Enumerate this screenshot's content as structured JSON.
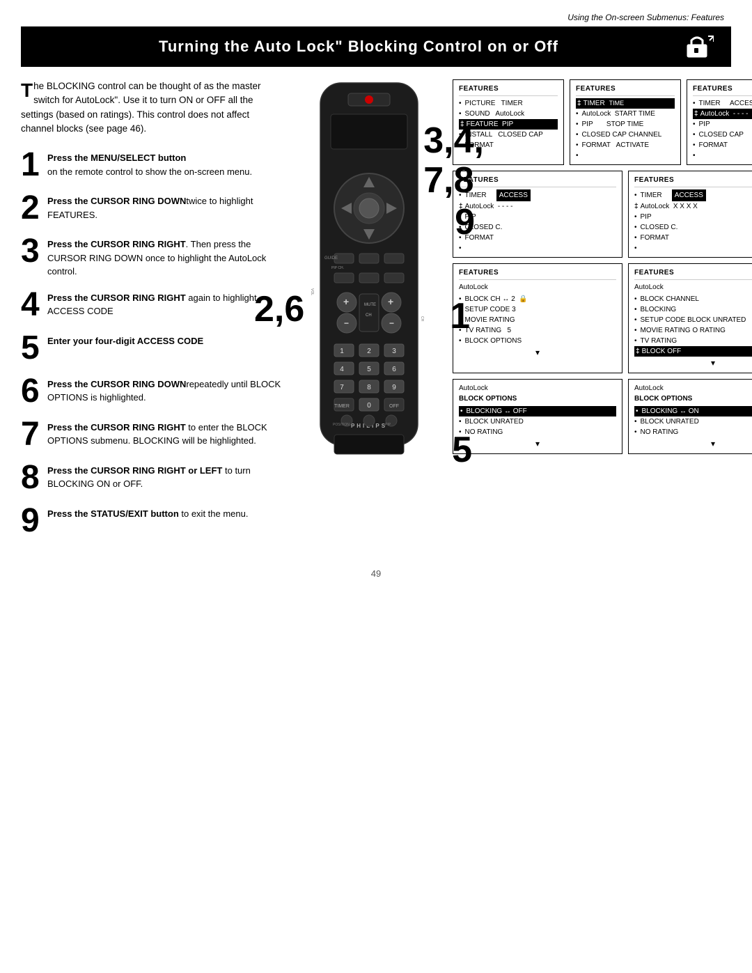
{
  "page": {
    "header": "Using the On-screen Submenus: Features",
    "title": "Turning the Auto Lock\" Blocking Control on or Off",
    "footer_page_num": "49"
  },
  "intro": {
    "text1": "he BLOCKING control can be thought of as the  master switch  for AutoLock\". Use it to turn ON or OFF all the settings (based on ratings). This control does not affect channel blocks (see page 46)."
  },
  "steps": [
    {
      "number": "1",
      "bold": "Press the MENU/SELECT button",
      "rest": " on the remote control to show the on-screen menu."
    },
    {
      "number": "2",
      "bold": "Press the CURSOR RING DOWN",
      "rest": "twice to highlight FEATURES."
    },
    {
      "number": "3",
      "bold": "Press the CURSOR RING RIGHT",
      "rest": ". Then press the CURSOR RING DOWN once to highlight the AutoLock control."
    },
    {
      "number": "4",
      "bold": "Press the CURSOR RING RIGHT",
      "rest": " again to highlight ACCESS CODE."
    },
    {
      "number": "5",
      "bold": "Enter your four-digit ACCESS CODE"
    },
    {
      "number": "6",
      "bold": "Press the CURSOR RING DOWN",
      "rest": "repeatedly until BLOCK OPTIONS is highlighted."
    },
    {
      "number": "7",
      "bold": "Press the CURSOR RING RIGHT",
      "rest": " to enter the BLOCK OPTIONS submenu. BLOCKING will be highlighted."
    },
    {
      "number": "8",
      "bold": "Press the CURSOR RING RIGHT or LEFT",
      "rest": " to turn BLOCKING ON or OFF."
    },
    {
      "number": "9",
      "bold": "Press the STATUS/EXIT button",
      "rest": " to exit the menu."
    }
  ],
  "menus": {
    "row1": [
      {
        "title": "FEATURES",
        "items": [
          {
            "marker": "•",
            "text": "PICTURE   TIMER",
            "highlight": false
          },
          {
            "marker": "•",
            "text": "SOUND    AutoLock",
            "highlight": false
          },
          {
            "marker": "‡",
            "text": "FEATURE  PIP",
            "highlight": true
          },
          {
            "marker": "•",
            "text": "INSTALL   CLOSED CAP",
            "highlight": false
          },
          {
            "marker": "",
            "text": "FORMAT",
            "highlight": false
          }
        ]
      },
      {
        "title": "FEATURES",
        "items": [
          {
            "marker": "‡",
            "text": "TIMER      TIME",
            "highlight": true
          },
          {
            "marker": "•",
            "text": "AutoLock  START TIME",
            "highlight": false
          },
          {
            "marker": "•",
            "text": "PIP        STOP TIME",
            "highlight": false
          },
          {
            "marker": "•",
            "text": "CLOSED CAP CHANNEL",
            "highlight": false
          },
          {
            "marker": "•",
            "text": "FORMAT   ACTIVATE",
            "highlight": false
          }
        ]
      },
      {
        "title": "FEATURES",
        "items": [
          {
            "marker": "•",
            "text": "TIMER      ACCESS CODE",
            "highlight": false
          },
          {
            "marker": "‡",
            "text": "AutoLock  - - - -",
            "highlight": true
          },
          {
            "marker": "•",
            "text": "PIP",
            "highlight": false
          },
          {
            "marker": "•",
            "text": "CLOSED CAP",
            "highlight": false
          },
          {
            "marker": "•",
            "text": "FORMAT",
            "highlight": false
          }
        ]
      }
    ],
    "row2": [
      {
        "title": "FEATURES",
        "items": [
          {
            "marker": "•",
            "text": "TIMER",
            "highlight": false,
            "access": "ACCESS"
          },
          {
            "marker": "‡",
            "text": "AutoLock  - - - -",
            "highlight": false
          },
          {
            "marker": "•",
            "text": "PIP",
            "highlight": false
          },
          {
            "marker": "•",
            "text": "CLOSED C.",
            "highlight": false
          },
          {
            "marker": "•",
            "text": "FORMAT",
            "highlight": false
          }
        ]
      },
      {
        "title": "FEATURES",
        "items": [
          {
            "marker": "•",
            "text": "TIMER",
            "highlight": false,
            "access": "ACCESS"
          },
          {
            "marker": "‡",
            "text": "AutoLock  X X X X",
            "highlight": false
          },
          {
            "marker": "•",
            "text": "PIP",
            "highlight": false
          },
          {
            "marker": "•",
            "text": "CLOSED C.",
            "highlight": false
          },
          {
            "marker": "•",
            "text": "FORMAT",
            "highlight": false
          }
        ]
      }
    ],
    "row3": [
      {
        "title": "FEATURES",
        "subtitle": "AutoLock",
        "items": [
          {
            "marker": "•",
            "text": "BLOCK CH ↔ 2  🔒",
            "highlight": false
          },
          {
            "marker": "•",
            "text": "SETUP CODE 3",
            "highlight": false
          },
          {
            "marker": "•",
            "text": "MOVIE RATING",
            "highlight": false
          },
          {
            "marker": "•",
            "text": "TV RATING   5",
            "highlight": false
          },
          {
            "marker": "•",
            "text": "BLOCK OPTIONS",
            "highlight": false
          }
        ]
      },
      {
        "title": "FEATURES",
        "subtitle": "AutoLock",
        "items": [
          {
            "marker": "•",
            "text": "BLOCK CHANNEL",
            "highlight": false
          },
          {
            "marker": "•",
            "text": "BLOCKING",
            "highlight": false
          },
          {
            "marker": "•",
            "text": "SETUP CODE BLOCK UNRATED",
            "highlight": false
          },
          {
            "marker": "•",
            "text": "MOVIE RATING O RATING",
            "highlight": false
          },
          {
            "marker": "•",
            "text": "TV RATING",
            "highlight": false
          },
          {
            "marker": "‡",
            "text": "BLOCK OFF",
            "highlight": true
          }
        ]
      }
    ],
    "row4": [
      {
        "title": "AutoLock",
        "subtitle": "BLOCK OPTIONS",
        "items": [
          {
            "marker": "•",
            "text": "BLOCKING ↔ OFF",
            "highlight": true
          },
          {
            "marker": "•",
            "text": "BLOCK UNRATED",
            "highlight": false
          },
          {
            "marker": "•",
            "text": "NO RATING",
            "highlight": false
          }
        ]
      },
      {
        "title": "AutoLock",
        "subtitle": "BLOCK OPTIONS",
        "items": [
          {
            "marker": "•",
            "text": "BLOCKING ↔ ON",
            "highlight": true
          },
          {
            "marker": "•",
            "text": "BLOCK UNRATED",
            "highlight": false
          },
          {
            "marker": "•",
            "text": "NO RATING",
            "highlight": false
          }
        ]
      }
    ]
  },
  "remote": {
    "philips_label": "PHILIPS",
    "numpad": [
      "1",
      "2",
      "3",
      "4",
      "5",
      "6",
      "7",
      "8",
      "9",
      "TIMER",
      "0",
      "OFF"
    ]
  },
  "overlay_numbers": {
    "n34_78": "3,4,\n7,8",
    "n9": "9",
    "n26": "2,6",
    "n1": "1",
    "n5b": "5"
  }
}
